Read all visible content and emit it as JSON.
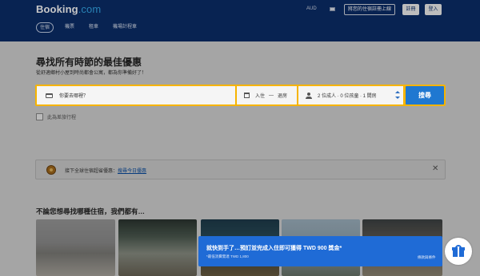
{
  "header": {
    "logo_main": "Booking",
    "logo_suffix": ".com",
    "currency": "AUD",
    "list_property": "將您的住宿註冊上線",
    "register": "註冊",
    "login": "登入",
    "tabs": [
      {
        "label": "住宿",
        "active": true
      },
      {
        "label": "機票",
        "active": false
      },
      {
        "label": "租車",
        "active": false
      },
      {
        "label": "機場計程車",
        "active": false
      }
    ]
  },
  "hero": {
    "title": "尋找所有時節的最佳優惠",
    "subtitle": "從舒適鄉村小屋到時尚都會公寓，都為你準備好了！"
  },
  "search": {
    "destination_placeholder": "你要去哪裡？",
    "checkin": "入住",
    "separator": "—",
    "checkout": "退房",
    "guests": "2 位成人 · 0 位孩童 · 1 間房",
    "button": "搜尋",
    "business_trip": "此為差旅行程"
  },
  "promo": {
    "text": "接下全球住宿超省優惠：",
    "link": "搜尋今日優惠",
    "close": "✕"
  },
  "section": {
    "title": "不論您想尋找哪種住宿，我們都有…"
  },
  "reward": {
    "title": "就快到手了…預訂並完成入住即可獲得 TWD 900 獎金*",
    "subtitle": "*最低消費需達 TWD 1,800",
    "terms": "條款與條件"
  },
  "colors": {
    "header_bg": "#0b2d6a",
    "search_border": "#f6b400",
    "search_button": "#1f78d1",
    "reward_bg": "#1f6bd6"
  }
}
